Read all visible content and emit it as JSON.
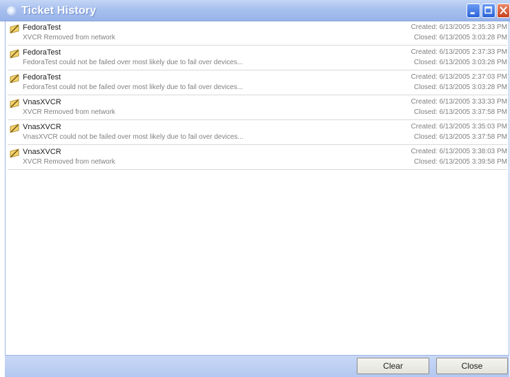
{
  "window": {
    "title": "Ticket History",
    "controls": {
      "minimize": "minimize-icon",
      "maximize": "maximize-icon",
      "close": "close-icon"
    }
  },
  "tickets": [
    {
      "name": "FedoraTest",
      "message": "XVCR Removed from network",
      "created": "Created: 6/13/2005 2:35:33 PM",
      "closed": "Closed: 6/13/2005 3:03:28 PM"
    },
    {
      "name": "FedoraTest",
      "message": "FedoraTest could not be failed over most likely due to fail over devices...",
      "created": "Created: 6/13/2005 2:37:33 PM",
      "closed": "Closed: 6/13/2005 3:03:28 PM"
    },
    {
      "name": "FedoraTest",
      "message": "FedoraTest could not be failed over most likely due to fail over devices...",
      "created": "Created: 6/13/2005 2:37:03 PM",
      "closed": "Closed: 6/13/2005 3:03:28 PM"
    },
    {
      "name": "VnasXVCR",
      "message": "XVCR Removed from network",
      "created": "Created: 6/13/2005 3:33:33 PM",
      "closed": "Closed: 6/13/2005 3:37:58 PM"
    },
    {
      "name": "VnasXVCR",
      "message": "VnasXVCR could not be failed over most likely due to fail over devices...",
      "created": "Created: 6/13/2005 3:35:03 PM",
      "closed": "Closed: 6/13/2005 3:37:58 PM"
    },
    {
      "name": "VnasXVCR",
      "message": "XVCR Removed from network",
      "created": "Created: 6/13/2005 3:38:03 PM",
      "closed": "Closed: 6/13/2005 3:39:58 PM"
    }
  ],
  "footer": {
    "clear_label": "Clear",
    "close_label": "Close"
  },
  "colors": {
    "titlebar": "#a8c0ee",
    "footer": "#b3c8f0",
    "close_button": "#c8401e"
  }
}
